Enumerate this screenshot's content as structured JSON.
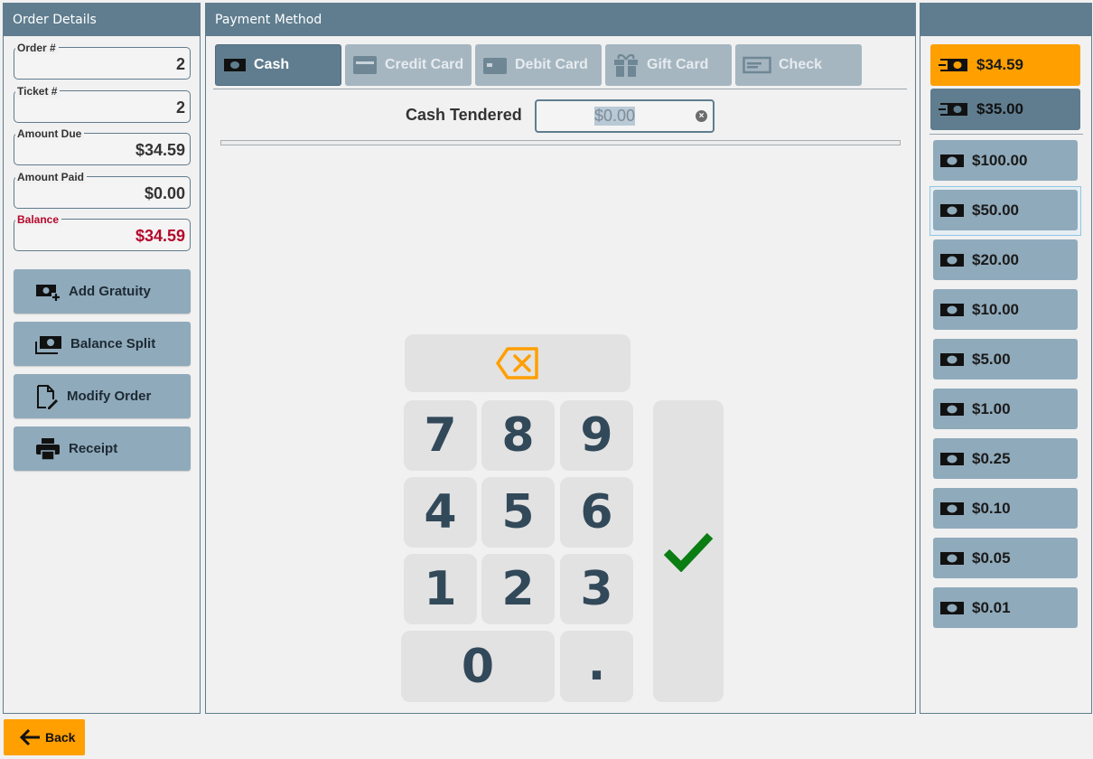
{
  "left": {
    "header": "Order Details",
    "fields": [
      {
        "label": "Order #",
        "value": "2"
      },
      {
        "label": "Ticket #",
        "value": "2"
      },
      {
        "label": "Amount Due",
        "value": "$34.59"
      },
      {
        "label": "Amount Paid",
        "value": "$0.00"
      },
      {
        "label": "Balance",
        "value": "$34.59"
      }
    ],
    "buttons": [
      {
        "label": "Add Gratuity",
        "icon": "money-add-icon"
      },
      {
        "label": "Balance Split",
        "icon": "money-stack-icon"
      },
      {
        "label": "Modify Order",
        "icon": "document-edit-icon"
      },
      {
        "label": "Receipt",
        "icon": "printer-icon"
      }
    ]
  },
  "middle": {
    "header": "Payment Method",
    "tabs": [
      {
        "label": "Cash",
        "icon": "cash-icon",
        "active": true
      },
      {
        "label": "Credit Card",
        "icon": "credit-card-icon",
        "active": false
      },
      {
        "label": "Debit Card",
        "icon": "debit-card-icon",
        "active": false
      },
      {
        "label": "Gift Card",
        "icon": "gift-icon",
        "active": false
      },
      {
        "label": "Check",
        "icon": "check-icon",
        "active": false
      }
    ],
    "cash_tendered_label": "Cash Tendered",
    "cash_tendered_value": "$0.00",
    "keypad": [
      "7",
      "8",
      "9",
      "4",
      "5",
      "6",
      "1",
      "2",
      "3",
      "0",
      "."
    ],
    "colors": {
      "accent": "#ff9f00",
      "confirm": "#0a7d13",
      "key_text": "#32495a"
    }
  },
  "right": {
    "quick_amounts": [
      "$34.59",
      "$35.00"
    ],
    "denominations": [
      "$100.00",
      "$50.00",
      "$20.00",
      "$10.00",
      "$5.00",
      "$1.00",
      "$0.25",
      "$0.10",
      "$0.05",
      "$0.01"
    ]
  },
  "footer": {
    "back_label": "Back"
  }
}
